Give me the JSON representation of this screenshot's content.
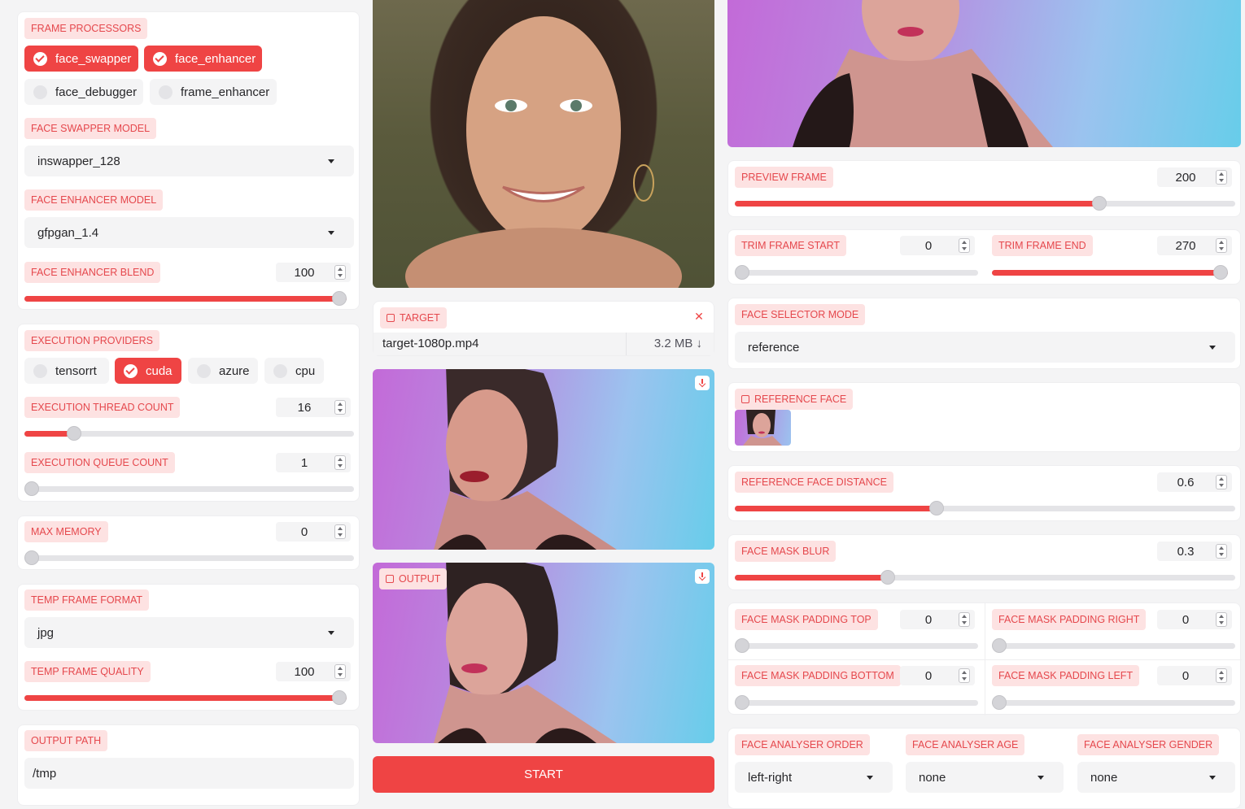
{
  "left": {
    "frame_processors": {
      "label": "FRAME PROCESSORS",
      "options": [
        {
          "label": "face_swapper",
          "checked": true
        },
        {
          "label": "face_enhancer",
          "checked": true
        },
        {
          "label": "face_debugger",
          "checked": false
        },
        {
          "label": "frame_enhancer",
          "checked": false
        }
      ]
    },
    "face_swapper_model": {
      "label": "FACE SWAPPER MODEL",
      "value": "inswapper_128"
    },
    "face_enhancer_model": {
      "label": "FACE ENHANCER MODEL",
      "value": "gfpgan_1.4"
    },
    "face_enhancer_blend": {
      "label": "FACE ENHANCER BLEND",
      "value": "100",
      "fraction": 1.0
    },
    "execution_providers": {
      "label": "EXECUTION PROVIDERS",
      "options": [
        {
          "label": "tensorrt",
          "checked": false
        },
        {
          "label": "cuda",
          "checked": true
        },
        {
          "label": "azure",
          "checked": false
        },
        {
          "label": "cpu",
          "checked": false
        }
      ]
    },
    "execution_thread_count": {
      "label": "EXECUTION THREAD COUNT",
      "value": "16",
      "fraction": 0.135
    },
    "execution_queue_count": {
      "label": "EXECUTION QUEUE COUNT",
      "value": "1",
      "fraction": 0.0
    },
    "max_memory": {
      "label": "MAX MEMORY",
      "value": "0",
      "fraction": 0.0
    },
    "temp_frame_format": {
      "label": "TEMP FRAME FORMAT",
      "value": "jpg"
    },
    "temp_frame_quality": {
      "label": "TEMP FRAME QUALITY",
      "value": "100",
      "fraction": 1.0
    },
    "output_path": {
      "label": "OUTPUT PATH",
      "value": "/tmp"
    }
  },
  "middle": {
    "target": {
      "label": "TARGET",
      "filename": "target-1080p.mp4",
      "size": "3.2 MB ↓"
    },
    "output": {
      "label": "OUTPUT"
    },
    "start_button": "START"
  },
  "right": {
    "preview_frame": {
      "label": "PREVIEW FRAME",
      "value": "200",
      "fraction": 0.735
    },
    "trim_frame_start": {
      "label": "TRIM FRAME START",
      "value": "0",
      "fraction": 0.0
    },
    "trim_frame_end": {
      "label": "TRIM FRAME END",
      "value": "270",
      "fraction": 1.0
    },
    "face_selector_mode": {
      "label": "FACE SELECTOR MODE",
      "value": "reference"
    },
    "reference_face": {
      "label": "REFERENCE FACE"
    },
    "reference_face_distance": {
      "label": "REFERENCE FACE DISTANCE",
      "value": "0.6",
      "fraction": 0.4
    },
    "face_mask_blur": {
      "label": "FACE MASK BLUR",
      "value": "0.3",
      "fraction": 0.3
    },
    "face_mask_padding_top": {
      "label": "FACE MASK PADDING TOP",
      "value": "0",
      "fraction": 0.0
    },
    "face_mask_padding_right": {
      "label": "FACE MASK PADDING RIGHT",
      "value": "0",
      "fraction": 0.0
    },
    "face_mask_padding_bottom": {
      "label": "FACE MASK PADDING BOTTOM",
      "value": "0",
      "fraction": 0.0
    },
    "face_mask_padding_left": {
      "label": "FACE MASK PADDING LEFT",
      "value": "0",
      "fraction": 0.0
    },
    "face_analyser_order": {
      "label": "FACE ANALYSER ORDER",
      "value": "left-right"
    },
    "face_analyser_age": {
      "label": "FACE ANALYSER AGE",
      "value": "none"
    },
    "face_analyser_gender": {
      "label": "FACE ANALYSER GENDER",
      "value": "none"
    }
  },
  "colors": {
    "accent": "#ef4444",
    "accent_light": "#fde2e2",
    "track": "#e4e4e7"
  }
}
